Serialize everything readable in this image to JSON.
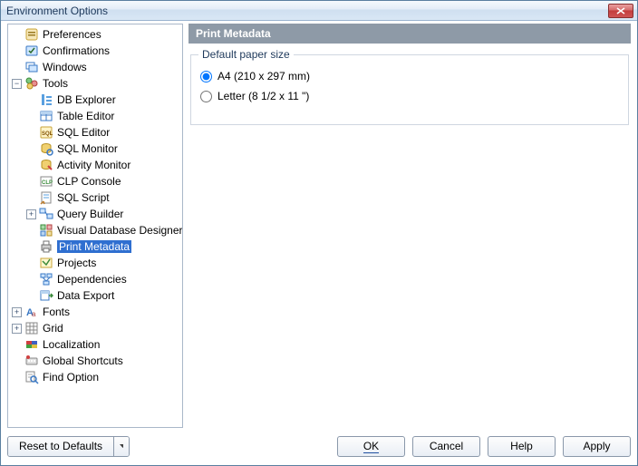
{
  "window": {
    "title": "Environment Options"
  },
  "section": {
    "header": "Print Metadata"
  },
  "group": {
    "title": "Default paper size"
  },
  "radios": {
    "a4": {
      "label": "A4 (210 x 297 mm)",
      "checked": true
    },
    "letter": {
      "label": "Letter (8 1/2 x 11 \")",
      "checked": false
    }
  },
  "buttons": {
    "reset": "Reset to Defaults",
    "ok": "OK",
    "cancel": "Cancel",
    "help": "Help",
    "apply": "Apply"
  },
  "tree": {
    "preferences": "Preferences",
    "confirmations": "Confirmations",
    "windows": "Windows",
    "tools": "Tools",
    "db_explorer": "DB Explorer",
    "table_editor": "Table Editor",
    "sql_editor": "SQL Editor",
    "sql_monitor": "SQL Monitor",
    "activity_monitor": "Activity Monitor",
    "clp_console": "CLP Console",
    "sql_script": "SQL Script",
    "query_builder": "Query Builder",
    "visual_db_designer": "Visual Database Designer",
    "print_metadata": "Print Metadata",
    "projects": "Projects",
    "dependencies": "Dependencies",
    "data_export": "Data Export",
    "fonts": "Fonts",
    "grid": "Grid",
    "localization": "Localization",
    "global_shortcuts": "Global Shortcuts",
    "find_option": "Find Option"
  }
}
